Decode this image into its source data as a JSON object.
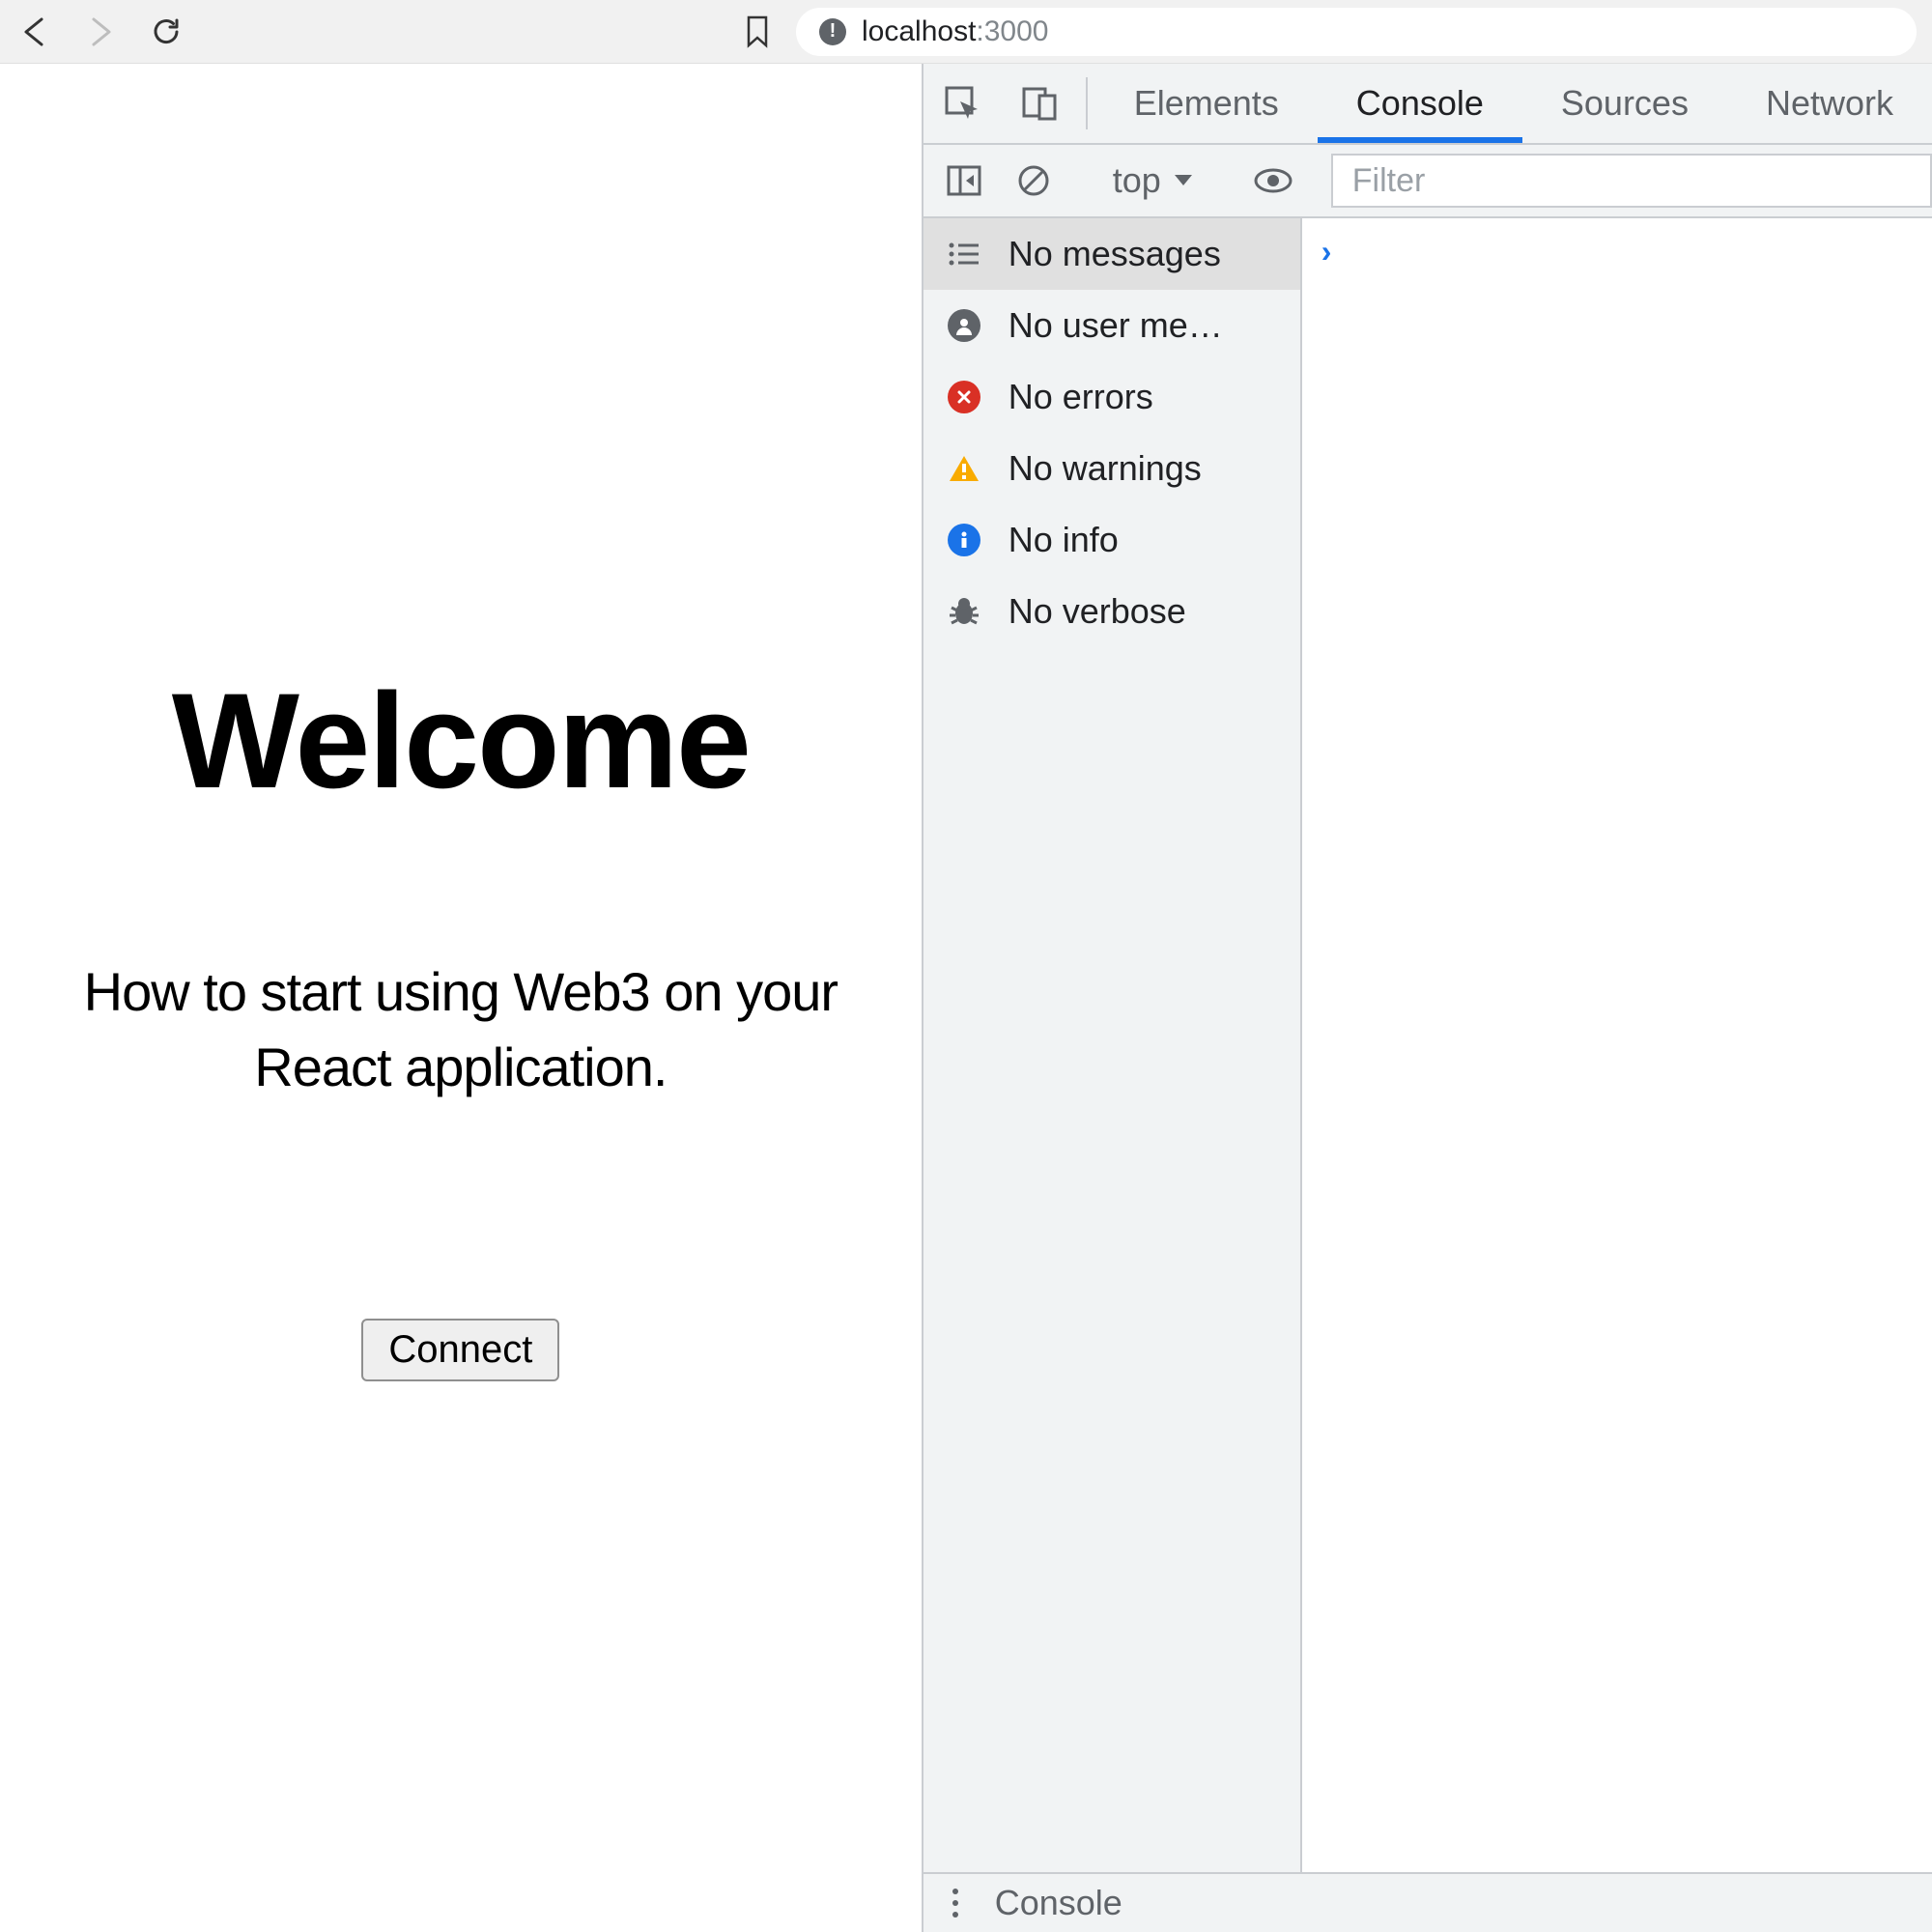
{
  "browser": {
    "url_host": "localhost",
    "url_path": ":3000"
  },
  "page": {
    "heading": "Welcome",
    "subtitle": "How to start using Web3 on your React application.",
    "button": "Connect"
  },
  "devtools": {
    "tabs": {
      "elements": "Elements",
      "console": "Console",
      "sources": "Sources",
      "network": "Network"
    },
    "toolbar": {
      "context": "top",
      "filter_placeholder": "Filter"
    },
    "sidebar": {
      "messages": "No messages",
      "user_messages": "No user me…",
      "errors": "No errors",
      "warnings": "No warnings",
      "info": "No info",
      "verbose": "No verbose"
    },
    "drawer": {
      "label": "Console"
    }
  }
}
